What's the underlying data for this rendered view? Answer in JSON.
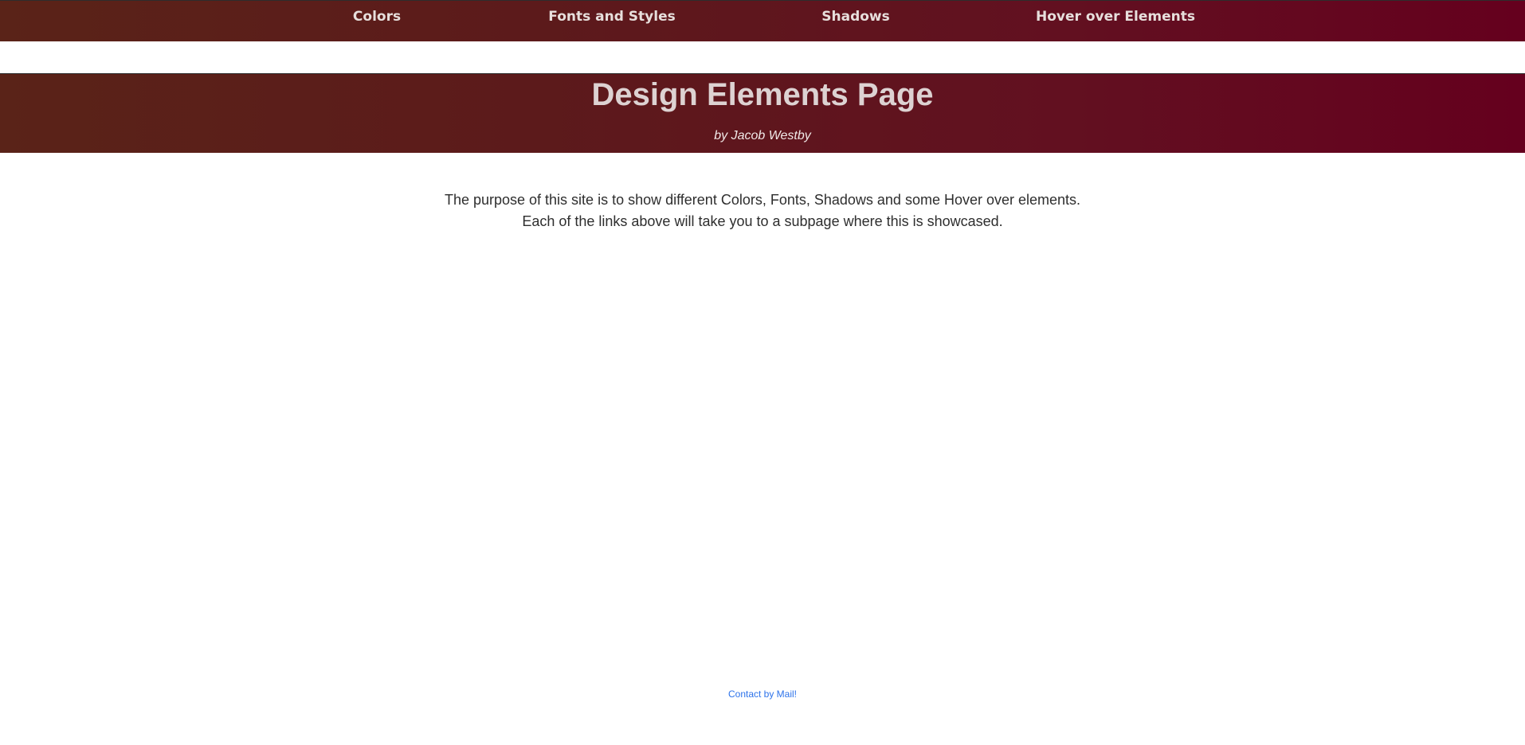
{
  "nav": {
    "items": [
      {
        "label": "Colors"
      },
      {
        "label": "Fonts and Styles"
      },
      {
        "label": "Shadows"
      },
      {
        "label": "Hover over Elements"
      }
    ]
  },
  "header": {
    "title": "Design Elements Page",
    "byline": "by Jacob Westby"
  },
  "main": {
    "line1": "The purpose of this site is to show different Colors, Fonts, Shadows and some Hover over elements.",
    "line2": "Each of the links above will take you to a subpage where this is showcased."
  },
  "footer": {
    "contact_label": "Contact by Mail!"
  },
  "colors": {
    "gradient_left": "#5a2318",
    "gradient_right": "#65001e",
    "nav_text": "#e7dfdc",
    "title_text": "#ddd2d2",
    "body_text": "#2e2e2e",
    "link": "#2d73ea"
  }
}
